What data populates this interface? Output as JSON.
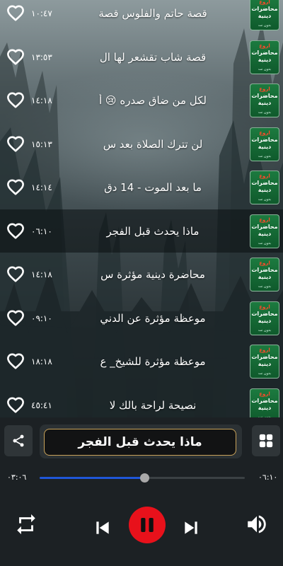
{
  "tracks": [
    {
      "title": "قصة حاتم والفلوس قصة",
      "duration": "١٠:٤٧"
    },
    {
      "title": "قصة شاب تقشعر لها ال",
      "duration": "١٣:٥٣"
    },
    {
      "title": "لكل من ضاق صدره 😢 أ",
      "duration": "١٤:١٨"
    },
    {
      "title": "لن تترك الصلاة بعد س",
      "duration": "١٥:١٣"
    },
    {
      "title": "ما بعد الموت - 14 دق",
      "duration": "١٤:١٤"
    },
    {
      "title": "ماذا يحدث قبل الفجر",
      "duration": "٠٦:١٠"
    },
    {
      "title": "محاضرة دينية مؤثرة س",
      "duration": "١٤:١٨"
    },
    {
      "title": "موعظة مؤثرة عن الدني",
      "duration": "٠٩:١٠"
    },
    {
      "title": "موعظة مؤثرة للشيخ_ ع",
      "duration": "١٨:١٨"
    },
    {
      "title": "نصيحة لراحة بالك لا",
      "duration": "٤٥:٤١"
    }
  ],
  "active_index": 5,
  "thumbnail": {
    "line1": "اروع",
    "line2": "محاضرات دينية",
    "line3": "بدون نت"
  },
  "player": {
    "now_playing": "ماذا يحدث قبل الفجر",
    "elapsed": "٠٣:٠٦",
    "total": "٠٦:١٠",
    "progress": 0.51,
    "state": "playing"
  },
  "icons": {
    "favorite": "heart-outline-icon",
    "share": "share-icon",
    "menu": "grid-icon",
    "repeat": "repeat-icon",
    "previous": "skip-previous-icon",
    "pause": "pause-icon",
    "next": "skip-next-icon",
    "volume": "volume-icon"
  },
  "colors": {
    "accent_red": "#e8111b",
    "seek_blue": "#1f56d8",
    "title_border_gold": "#c9a35a"
  }
}
